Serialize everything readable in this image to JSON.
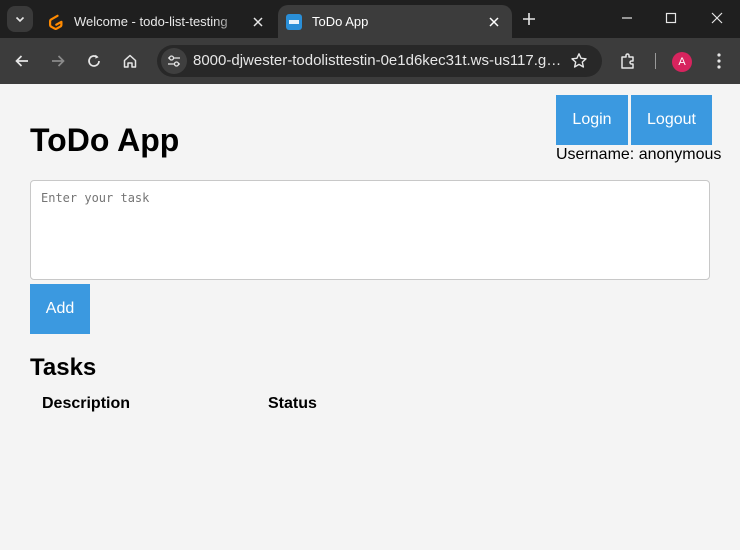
{
  "browser": {
    "tabs": [
      {
        "title": "Welcome - todo-list-testing",
        "active": false
      },
      {
        "title": "ToDo App",
        "active": true
      }
    ],
    "url": "8000-djwester-todolisttestin-0e1d6kec31t.ws-us117.gitpod.io",
    "profile_initial": "A",
    "colors": {
      "tab_bar": "#1f1f1f",
      "toolbar": "#3c3c3c",
      "avatar": "#d7245e"
    }
  },
  "header": {
    "login_label": "Login",
    "logout_label": "Logout",
    "username_text": "Username: anonymous"
  },
  "main": {
    "title": "ToDo App",
    "task_input": {
      "value": "",
      "placeholder": "Enter your task"
    },
    "add_label": "Add",
    "tasks_heading": "Tasks",
    "table": {
      "columns": [
        "Description",
        "Status"
      ],
      "rows": []
    }
  },
  "colors": {
    "button": "#3b99e0",
    "background": "#f4f4f4"
  }
}
